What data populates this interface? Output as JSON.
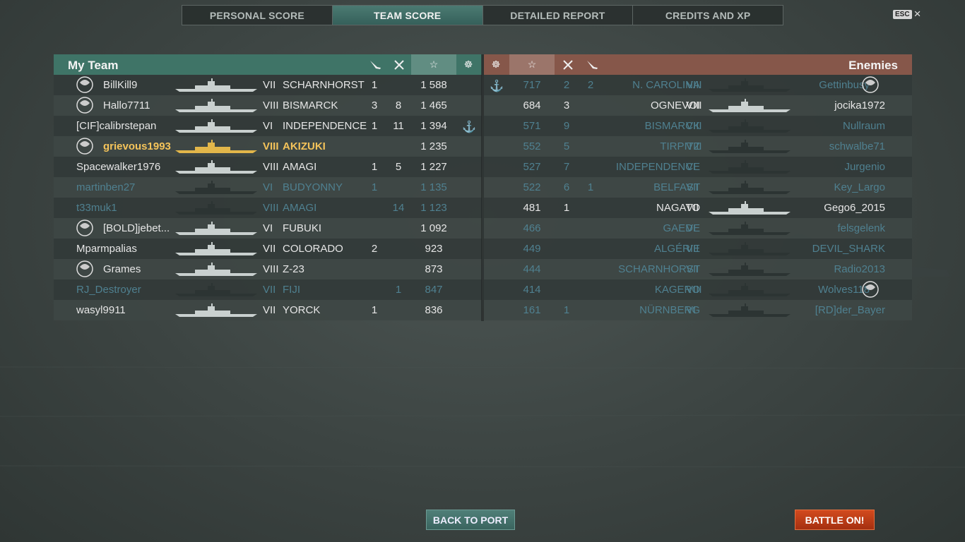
{
  "tabs": [
    {
      "label": "PERSONAL SCORE",
      "active": false
    },
    {
      "label": "TEAM SCORE",
      "active": true
    },
    {
      "label": "DETAILED REPORT",
      "active": false
    },
    {
      "label": "CREDITS AND XP",
      "active": false
    }
  ],
  "esc_label": "ESC",
  "my_team": {
    "title": "My Team",
    "players": [
      {
        "name": "BillKill9",
        "tier": "VII",
        "ship": "SCHARNHORST",
        "col_a": "1",
        "col_b": "",
        "score": "1 588",
        "cap": "",
        "status": "alive",
        "badge": true
      },
      {
        "name": "Hallo7711",
        "tier": "VIII",
        "ship": "BISMARCK",
        "col_a": "3",
        "col_b": "8",
        "score": "1 465",
        "cap": "",
        "status": "alive",
        "badge": true
      },
      {
        "name": "[CIF]calibrstepan",
        "tier": "VI",
        "ship": "INDEPENDENCE",
        "col_a": "1",
        "col_b": "11",
        "score": "1 394",
        "cap": "⚓",
        "status": "alive",
        "badge": false
      },
      {
        "name": "grievous1993",
        "tier": "VIII",
        "ship": "AKIZUKI",
        "col_a": "",
        "col_b": "",
        "score": "1 235",
        "cap": "",
        "status": "me",
        "badge": true
      },
      {
        "name": "Spacewalker1976",
        "tier": "VIII",
        "ship": "AMAGI",
        "col_a": "1",
        "col_b": "5",
        "score": "1 227",
        "cap": "",
        "status": "alive",
        "badge": false
      },
      {
        "name": "martinben27",
        "tier": "VI",
        "ship": "BUDYONNY",
        "col_a": "1",
        "col_b": "",
        "score": "1 135",
        "cap": "",
        "status": "dead",
        "badge": false
      },
      {
        "name": "t33muk1",
        "tier": "VIII",
        "ship": "AMAGI",
        "col_a": "",
        "col_b": "14",
        "score": "1 123",
        "cap": "",
        "status": "dead",
        "badge": false
      },
      {
        "name": "[BOLD]jebet...",
        "tier": "VI",
        "ship": "FUBUKI",
        "col_a": "",
        "col_b": "",
        "score": "1 092",
        "cap": "",
        "status": "alive",
        "badge": true
      },
      {
        "name": "Mparmpalias",
        "tier": "VII",
        "ship": "COLORADO",
        "col_a": "2",
        "col_b": "",
        "score": "923",
        "cap": "",
        "status": "alive",
        "badge": false
      },
      {
        "name": "Grames",
        "tier": "VIII",
        "ship": "Z-23",
        "col_a": "",
        "col_b": "",
        "score": "873",
        "cap": "",
        "status": "alive",
        "badge": true
      },
      {
        "name": "RJ_Destroyer",
        "tier": "VII",
        "ship": "FIJI",
        "col_a": "",
        "col_b": "1",
        "score": "847",
        "cap": "",
        "status": "dead",
        "badge": false
      },
      {
        "name": "wasyl9911",
        "tier": "VII",
        "ship": "YORCK",
        "col_a": "1",
        "col_b": "",
        "score": "836",
        "cap": "",
        "status": "alive",
        "badge": false
      }
    ]
  },
  "enemies": {
    "title": "Enemies",
    "players": [
      {
        "name": "Gettinbusy",
        "tier": "VIII",
        "ship": "N. CAROLINA",
        "col_a": "2",
        "col_b": "2",
        "score": "717",
        "cap": "⚓",
        "status": "dead",
        "badge": true
      },
      {
        "name": "jocika1972",
        "tier": "VIII",
        "ship": "OGNEVOI",
        "col_a": "3",
        "col_b": "",
        "score": "684",
        "cap": "",
        "status": "alive",
        "badge": false
      },
      {
        "name": "Nullraum",
        "tier": "VIII",
        "ship": "BISMARCK",
        "col_a": "9",
        "col_b": "",
        "score": "571",
        "cap": "",
        "status": "dead",
        "badge": false
      },
      {
        "name": "schwalbe71",
        "tier": "VIII",
        "ship": "TIRPITZ",
        "col_a": "5",
        "col_b": "",
        "score": "552",
        "cap": "",
        "status": "dead",
        "badge": false
      },
      {
        "name": "Jurgenio",
        "tier": "VI",
        "ship": "INDEPENDENCE",
        "col_a": "7",
        "col_b": "",
        "score": "527",
        "cap": "",
        "status": "dead",
        "badge": false
      },
      {
        "name": "Key_Largo",
        "tier": "VII",
        "ship": "BELFAST",
        "col_a": "6",
        "col_b": "1",
        "score": "522",
        "cap": "",
        "status": "dead",
        "badge": false
      },
      {
        "name": "Gego6_2015",
        "tier": "VII",
        "ship": "NAGATO",
        "col_a": "1",
        "col_b": "",
        "score": "481",
        "cap": "",
        "status": "alive",
        "badge": false
      },
      {
        "name": "felsgelenk",
        "tier": "VI",
        "ship": "GAEDE",
        "col_a": "",
        "col_b": "",
        "score": "466",
        "cap": "",
        "status": "dead",
        "badge": false
      },
      {
        "name": "DEVIL_SHARK",
        "tier": "VII",
        "ship": "ALGÉRIE",
        "col_a": "",
        "col_b": "",
        "score": "449",
        "cap": "",
        "status": "dead",
        "badge": false
      },
      {
        "name": "Radio2013",
        "tier": "VII",
        "ship": "SCHARNHORST",
        "col_a": "",
        "col_b": "",
        "score": "444",
        "cap": "",
        "status": "dead",
        "badge": false
      },
      {
        "name": "Wolves118",
        "tier": "VIII",
        "ship": "KAGERO",
        "col_a": "",
        "col_b": "",
        "score": "414",
        "cap": "",
        "status": "dead",
        "badge": true
      },
      {
        "name": "[RD]der_Bayer",
        "tier": "VI",
        "ship": "NÜRNBERG",
        "col_a": "1",
        "col_b": "",
        "score": "161",
        "cap": "",
        "status": "dead",
        "badge": false
      }
    ]
  },
  "buttons": {
    "back_to_port": "BACK TO PORT",
    "battle_on": "BATTLE ON!"
  },
  "colors": {
    "my_team_header": "#3f7467",
    "enemy_header": "#86574a",
    "dead_text": "#4f8090",
    "self_highlight": "#f4c35a",
    "battle_button": "#c23e18"
  },
  "icons": {
    "torpedo": "torpedo-icon",
    "aircraft_kill": "crossed-planes-icon",
    "score": "star-icon",
    "capture": "capture-icon"
  }
}
